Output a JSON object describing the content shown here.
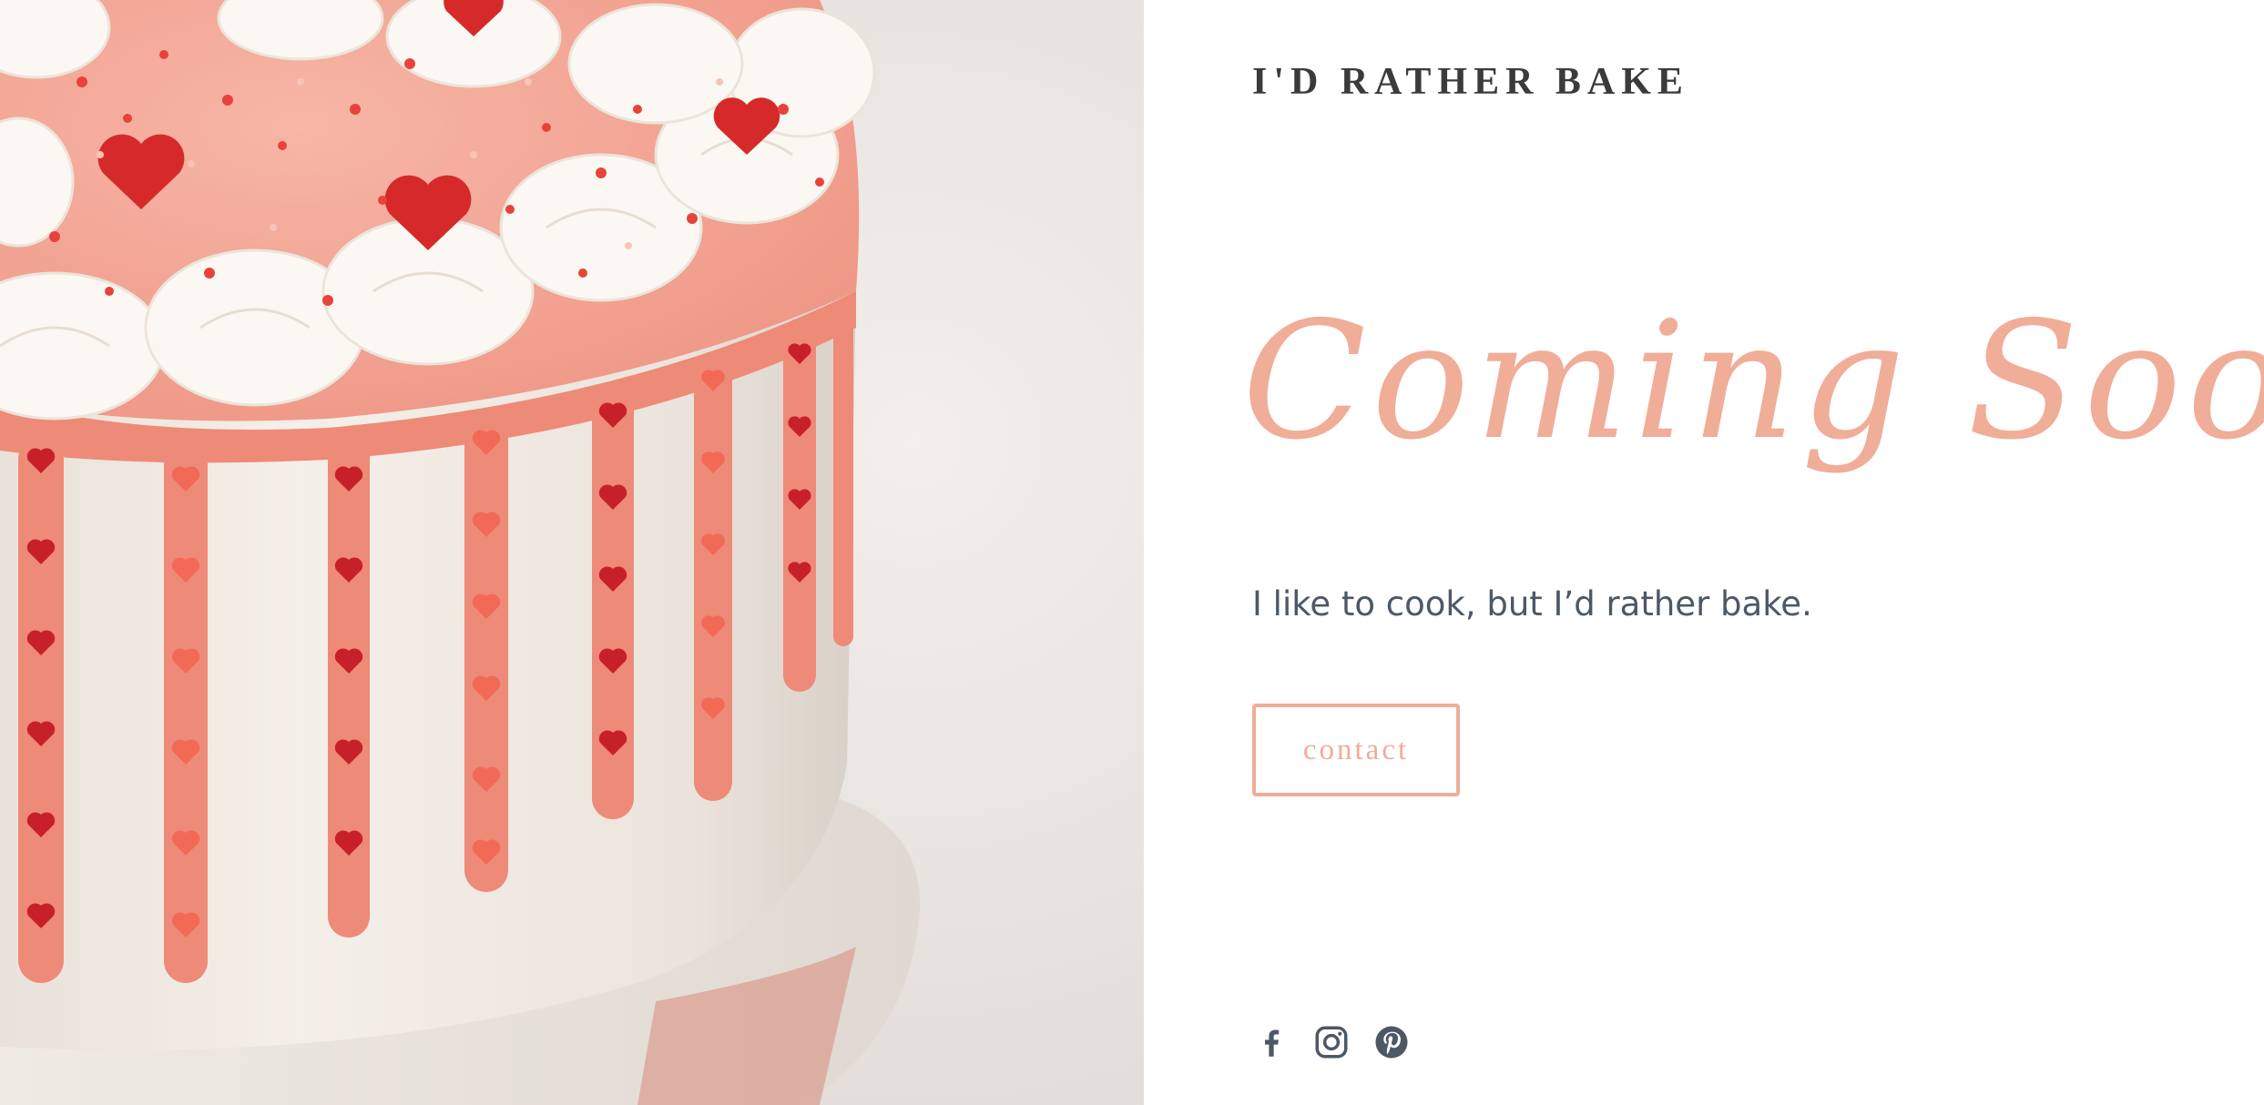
{
  "brand": {
    "name": "I'D RATHER BAKE"
  },
  "hero": {
    "image": "cake-photo",
    "colors": {
      "background": "#ece8e4",
      "frosting": "#f3efe9",
      "drip": "#ee8a78",
      "heart_sprinkle": "#c8202b"
    }
  },
  "main": {
    "headline": "Coming Soon",
    "tagline": "I like to cook, but I’d rather bake.",
    "contact_label": "contact"
  },
  "social": {
    "icons": [
      "facebook-icon",
      "instagram-icon",
      "pinterest-icon"
    ]
  },
  "colors": {
    "accent": "#f0ad98",
    "brand_text": "#3b3b3b",
    "body_text": "#4c5866",
    "icon": "#4c5866"
  }
}
